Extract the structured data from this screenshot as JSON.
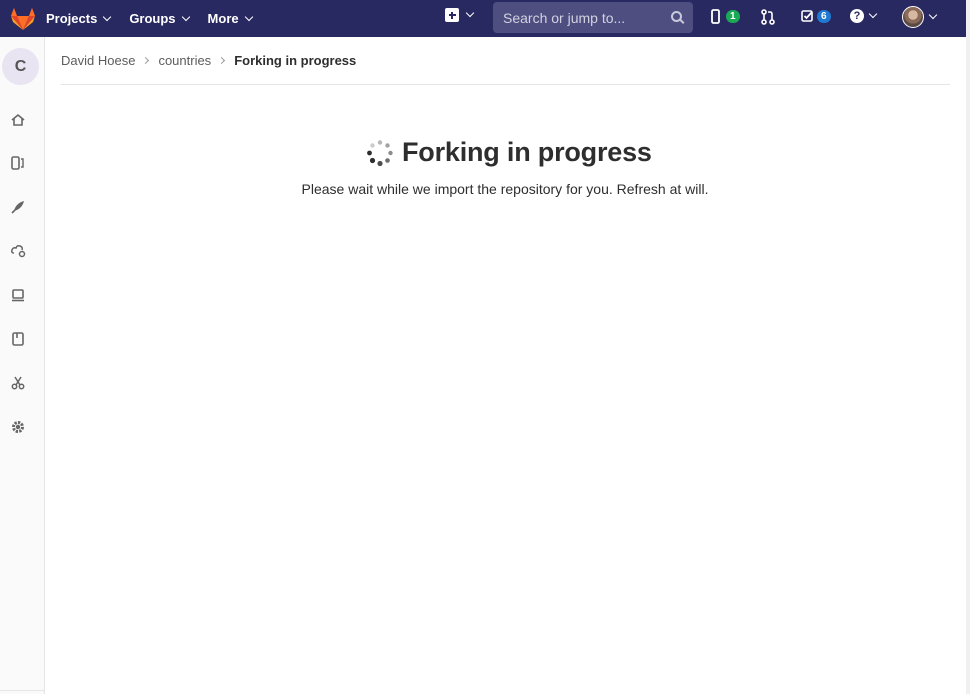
{
  "nav": {
    "projects": "Projects",
    "groups": "Groups",
    "more": "More",
    "search_placeholder": "Search or jump to...",
    "issues_count": "1",
    "todos_count": "6",
    "help_symbol": "?"
  },
  "sidebar": {
    "project_initial": "C",
    "icons": [
      "home-icon",
      "issues-icon",
      "ci-cd-icon",
      "operations-icon",
      "environments-icon",
      "wiki-icon",
      "snippets-icon",
      "settings-icon"
    ]
  },
  "breadcrumb": {
    "items": [
      "David Hoese",
      "countries"
    ],
    "current": "Forking in progress"
  },
  "main": {
    "title": "Forking in progress",
    "message": "Please wait while we import the repository for you. Refresh at will."
  },
  "colors": {
    "navbar": "#292961",
    "badge_green": "#1aaa55",
    "badge_blue": "#1f78d1"
  }
}
